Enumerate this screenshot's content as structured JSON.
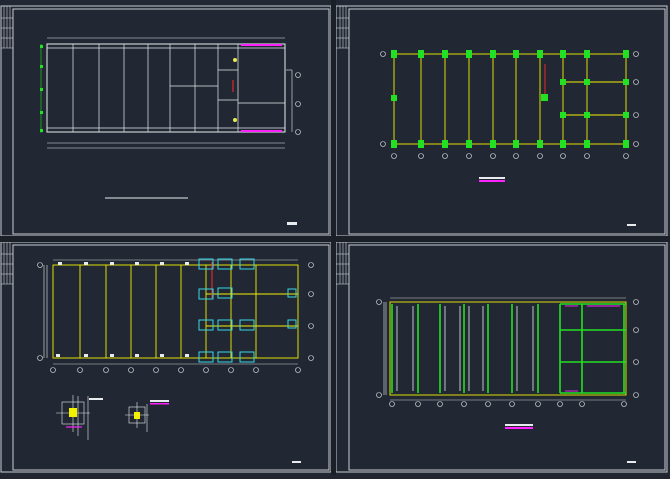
{
  "app": {
    "layout_count": 4
  },
  "colors": {
    "background": "#222833",
    "frame": "#c8ccd2",
    "white_lines": "#e8eaee",
    "yellow_beams": "#f2f200",
    "green_columns": "#22e022",
    "cyan_markers": "#36d8e8",
    "red_section": "#ff2a2a",
    "magenta_marks": "#ff22ff"
  },
  "sheets": [
    {
      "id": "sheet-top-left",
      "content": "floor-plan-outline"
    },
    {
      "id": "sheet-top-right",
      "content": "column-layout-plan"
    },
    {
      "id": "sheet-bottom-left",
      "content": "foundation-plan-with-details"
    },
    {
      "id": "sheet-bottom-right",
      "content": "beam-layout-plan"
    }
  ]
}
